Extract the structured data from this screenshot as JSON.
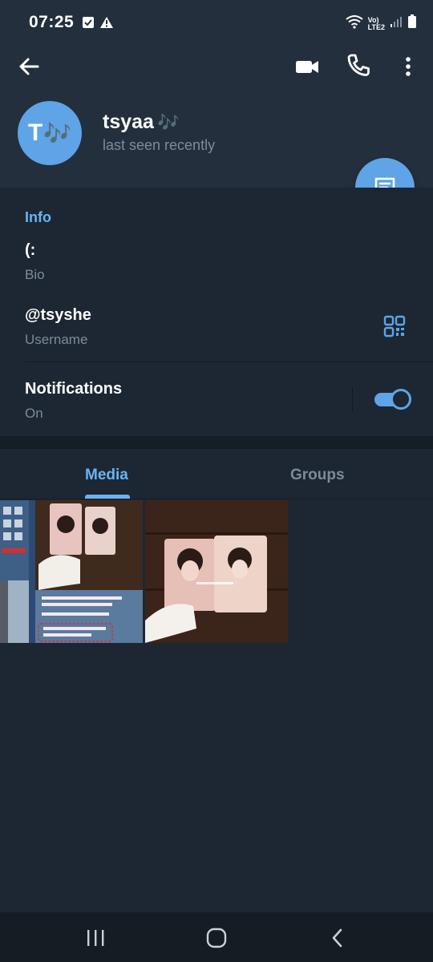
{
  "status_bar": {
    "time": "07:25",
    "network_top": "Vo)",
    "network_bottom": "LTE2"
  },
  "header": {
    "name": "tsyaa",
    "name_emoji": "🎶",
    "avatar_letter": "T",
    "avatar_emoji": "🎶",
    "status": "last seen recently"
  },
  "info": {
    "title": "Info",
    "bio_value": "(:",
    "bio_label": "Bio",
    "username_value": "@tsyshe",
    "username_label": "Username",
    "notifications_value": "Notifications",
    "notifications_label": "On",
    "notifications_enabled": true
  },
  "tabs": [
    {
      "label": "Media",
      "active": true
    },
    {
      "label": "Groups",
      "active": false
    }
  ],
  "media_items": [
    {
      "icon": "photo-listing-thumbnail"
    },
    {
      "icon": "photo-cards-thumbnail"
    }
  ],
  "colors": {
    "background": "#1d2733",
    "header": "#242f3d",
    "accent": "#5ea4e6",
    "link": "#6ab3f3",
    "muted": "#7d8b99"
  }
}
